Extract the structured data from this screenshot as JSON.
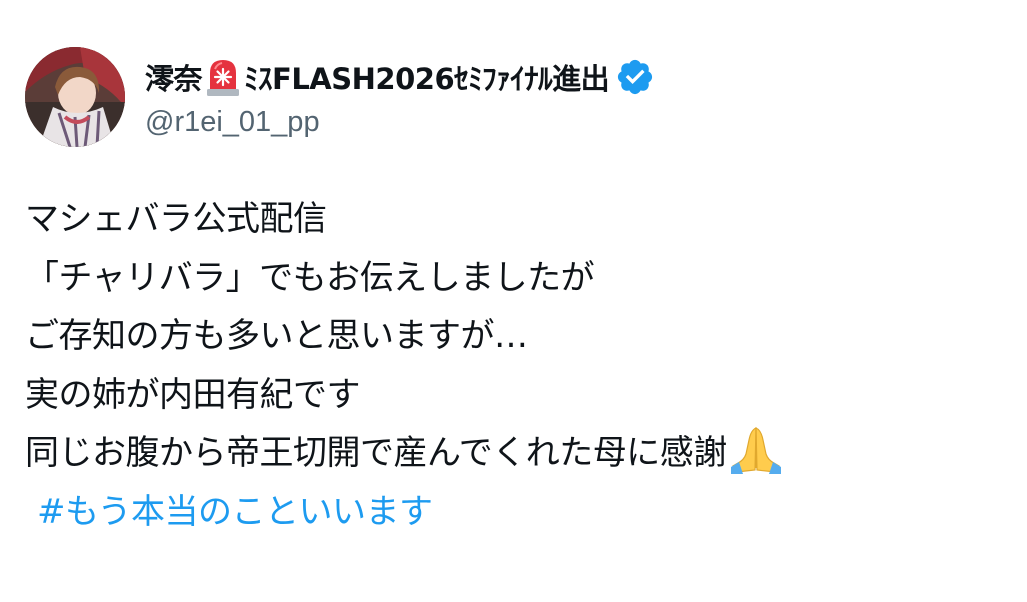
{
  "author": {
    "display_name_prefix": "澪奈",
    "display_name_suffix": "ﾐｽFLASH2026ｾﾐﾌｧｲﾅﾙ進出",
    "handle": "@r1ei_01_pp",
    "name_emoji": "rotating-light-icon",
    "verified_badge": "verified-badge-icon",
    "verified_color": "#1d9bf0"
  },
  "post": {
    "lines": [
      "マシェバラ公式配信",
      "「チャリバラ」でもお伝えしましたが",
      "ご存知の方も多いと思いますが…",
      "実の姉が内田有紀です",
      "同じお腹から帝王切開で産んでくれた母に感謝"
    ],
    "line_end_emoji": "folded-hands-icon",
    "hashtag": "#もう本当のこといいます",
    "hashtag_color": "#1d9bf0"
  }
}
